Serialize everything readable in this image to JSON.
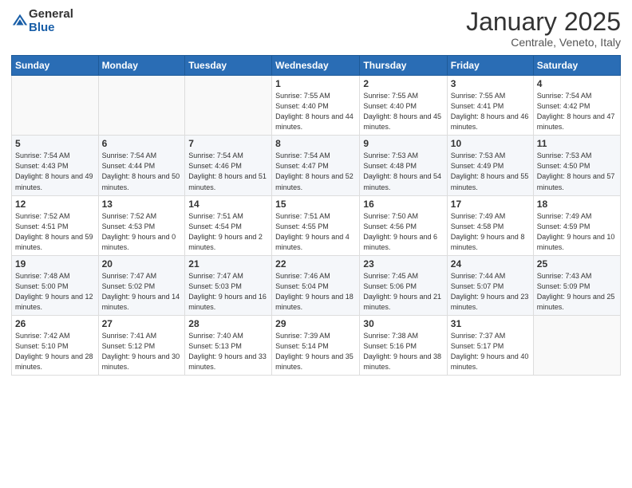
{
  "logo": {
    "general": "General",
    "blue": "Blue"
  },
  "header": {
    "month": "January 2025",
    "location": "Centrale, Veneto, Italy"
  },
  "weekdays": [
    "Sunday",
    "Monday",
    "Tuesday",
    "Wednesday",
    "Thursday",
    "Friday",
    "Saturday"
  ],
  "weeks": [
    [
      {
        "day": "",
        "info": ""
      },
      {
        "day": "",
        "info": ""
      },
      {
        "day": "",
        "info": ""
      },
      {
        "day": "1",
        "info": "Sunrise: 7:55 AM\nSunset: 4:40 PM\nDaylight: 8 hours\nand 44 minutes."
      },
      {
        "day": "2",
        "info": "Sunrise: 7:55 AM\nSunset: 4:40 PM\nDaylight: 8 hours\nand 45 minutes."
      },
      {
        "day": "3",
        "info": "Sunrise: 7:55 AM\nSunset: 4:41 PM\nDaylight: 8 hours\nand 46 minutes."
      },
      {
        "day": "4",
        "info": "Sunrise: 7:54 AM\nSunset: 4:42 PM\nDaylight: 8 hours\nand 47 minutes."
      }
    ],
    [
      {
        "day": "5",
        "info": "Sunrise: 7:54 AM\nSunset: 4:43 PM\nDaylight: 8 hours\nand 49 minutes."
      },
      {
        "day": "6",
        "info": "Sunrise: 7:54 AM\nSunset: 4:44 PM\nDaylight: 8 hours\nand 50 minutes."
      },
      {
        "day": "7",
        "info": "Sunrise: 7:54 AM\nSunset: 4:46 PM\nDaylight: 8 hours\nand 51 minutes."
      },
      {
        "day": "8",
        "info": "Sunrise: 7:54 AM\nSunset: 4:47 PM\nDaylight: 8 hours\nand 52 minutes."
      },
      {
        "day": "9",
        "info": "Sunrise: 7:53 AM\nSunset: 4:48 PM\nDaylight: 8 hours\nand 54 minutes."
      },
      {
        "day": "10",
        "info": "Sunrise: 7:53 AM\nSunset: 4:49 PM\nDaylight: 8 hours\nand 55 minutes."
      },
      {
        "day": "11",
        "info": "Sunrise: 7:53 AM\nSunset: 4:50 PM\nDaylight: 8 hours\nand 57 minutes."
      }
    ],
    [
      {
        "day": "12",
        "info": "Sunrise: 7:52 AM\nSunset: 4:51 PM\nDaylight: 8 hours\nand 59 minutes."
      },
      {
        "day": "13",
        "info": "Sunrise: 7:52 AM\nSunset: 4:53 PM\nDaylight: 9 hours\nand 0 minutes."
      },
      {
        "day": "14",
        "info": "Sunrise: 7:51 AM\nSunset: 4:54 PM\nDaylight: 9 hours\nand 2 minutes."
      },
      {
        "day": "15",
        "info": "Sunrise: 7:51 AM\nSunset: 4:55 PM\nDaylight: 9 hours\nand 4 minutes."
      },
      {
        "day": "16",
        "info": "Sunrise: 7:50 AM\nSunset: 4:56 PM\nDaylight: 9 hours\nand 6 minutes."
      },
      {
        "day": "17",
        "info": "Sunrise: 7:49 AM\nSunset: 4:58 PM\nDaylight: 9 hours\nand 8 minutes."
      },
      {
        "day": "18",
        "info": "Sunrise: 7:49 AM\nSunset: 4:59 PM\nDaylight: 9 hours\nand 10 minutes."
      }
    ],
    [
      {
        "day": "19",
        "info": "Sunrise: 7:48 AM\nSunset: 5:00 PM\nDaylight: 9 hours\nand 12 minutes."
      },
      {
        "day": "20",
        "info": "Sunrise: 7:47 AM\nSunset: 5:02 PM\nDaylight: 9 hours\nand 14 minutes."
      },
      {
        "day": "21",
        "info": "Sunrise: 7:47 AM\nSunset: 5:03 PM\nDaylight: 9 hours\nand 16 minutes."
      },
      {
        "day": "22",
        "info": "Sunrise: 7:46 AM\nSunset: 5:04 PM\nDaylight: 9 hours\nand 18 minutes."
      },
      {
        "day": "23",
        "info": "Sunrise: 7:45 AM\nSunset: 5:06 PM\nDaylight: 9 hours\nand 21 minutes."
      },
      {
        "day": "24",
        "info": "Sunrise: 7:44 AM\nSunset: 5:07 PM\nDaylight: 9 hours\nand 23 minutes."
      },
      {
        "day": "25",
        "info": "Sunrise: 7:43 AM\nSunset: 5:09 PM\nDaylight: 9 hours\nand 25 minutes."
      }
    ],
    [
      {
        "day": "26",
        "info": "Sunrise: 7:42 AM\nSunset: 5:10 PM\nDaylight: 9 hours\nand 28 minutes."
      },
      {
        "day": "27",
        "info": "Sunrise: 7:41 AM\nSunset: 5:12 PM\nDaylight: 9 hours\nand 30 minutes."
      },
      {
        "day": "28",
        "info": "Sunrise: 7:40 AM\nSunset: 5:13 PM\nDaylight: 9 hours\nand 33 minutes."
      },
      {
        "day": "29",
        "info": "Sunrise: 7:39 AM\nSunset: 5:14 PM\nDaylight: 9 hours\nand 35 minutes."
      },
      {
        "day": "30",
        "info": "Sunrise: 7:38 AM\nSunset: 5:16 PM\nDaylight: 9 hours\nand 38 minutes."
      },
      {
        "day": "31",
        "info": "Sunrise: 7:37 AM\nSunset: 5:17 PM\nDaylight: 9 hours\nand 40 minutes."
      },
      {
        "day": "",
        "info": ""
      }
    ]
  ]
}
